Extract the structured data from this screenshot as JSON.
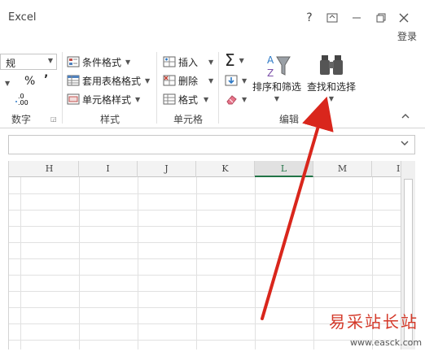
{
  "window": {
    "app_title": "Excel",
    "help_glyph": "?",
    "ribbon_display_glyph": "⊡",
    "restore_glyph": "❐",
    "close_glyph": "✕",
    "login_label": "登录"
  },
  "ribbon": {
    "number_group": {
      "format_value": "规",
      "percent": "%",
      "comma": "’",
      "increase_decimal": ".00",
      "group_label": "数字"
    },
    "styles_group": {
      "conditional_formatting": "条件格式",
      "format_as_table": "套用表格格式",
      "cell_styles": "单元格样式",
      "group_label": "样式"
    },
    "cells_group": {
      "insert": "插入",
      "delete": "删除",
      "format": "格式",
      "group_label": "单元格"
    },
    "editing_group": {
      "sort_filter": "排序和筛选",
      "find_select": "查找和选择",
      "group_label": "编辑"
    }
  },
  "grid": {
    "columns": [
      "H",
      "I",
      "J",
      "K",
      "L",
      "M",
      "I"
    ],
    "selected_column": "L"
  },
  "watermark": {
    "brand": "易采站长站",
    "url": "www.easck.com"
  },
  "colors": {
    "accent_green": "#217346",
    "arrow_red": "#d9261c",
    "watermark_red": "#d43a2a"
  }
}
